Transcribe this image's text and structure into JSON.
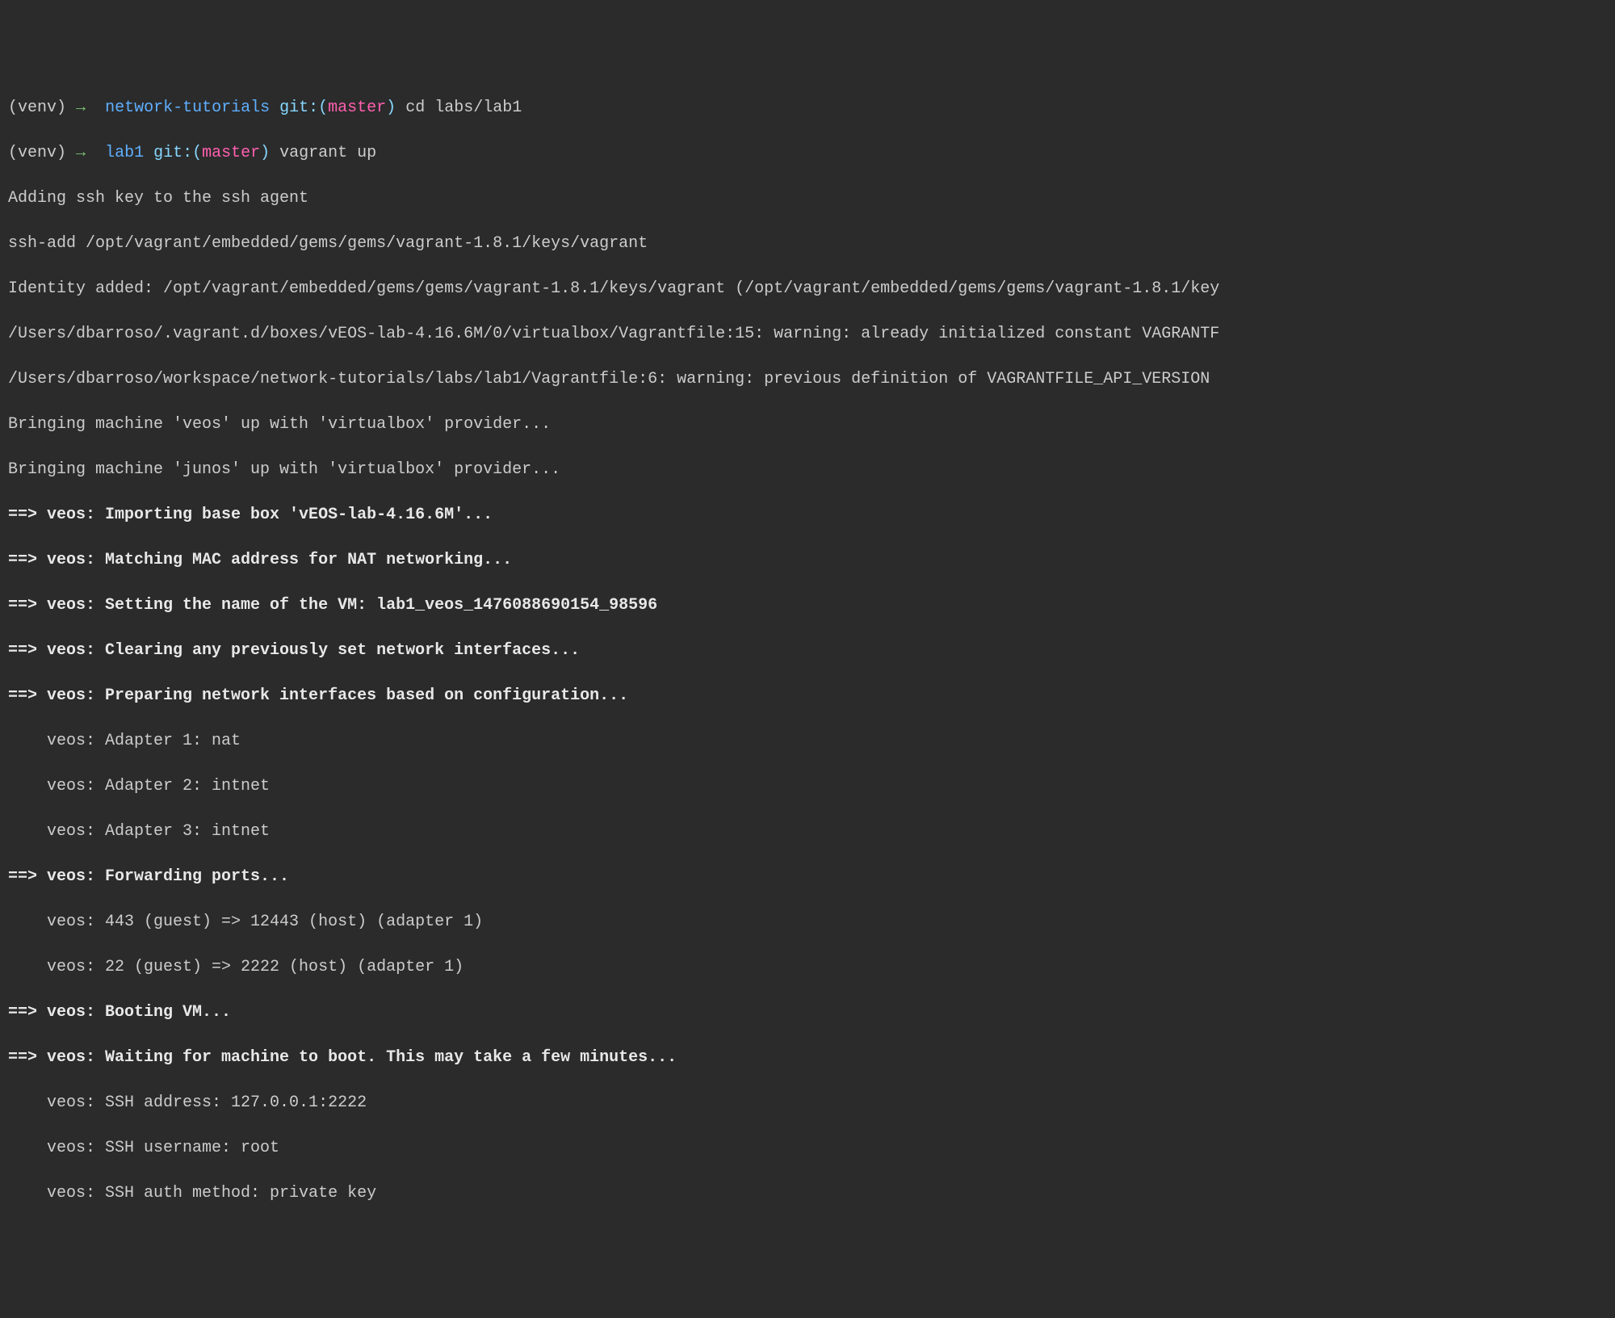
{
  "prompt1": {
    "venv": "(venv)",
    "arrow": "→",
    "dir": "network-tutorials",
    "git_label": "git:(",
    "branch": "master",
    "git_close": ")",
    "command": "cd labs/lab1"
  },
  "prompt2": {
    "venv": "(venv)",
    "arrow": "→",
    "dir": "lab1",
    "git_label": "git:(",
    "branch": "master",
    "git_close": ")",
    "command": "vagrant up"
  },
  "lines": {
    "l3": "Adding ssh key to the ssh agent",
    "l4": "ssh-add /opt/vagrant/embedded/gems/gems/vagrant-1.8.1/keys/vagrant",
    "l5": "Identity added: /opt/vagrant/embedded/gems/gems/vagrant-1.8.1/keys/vagrant (/opt/vagrant/embedded/gems/gems/vagrant-1.8.1/key",
    "l6": "/Users/dbarroso/.vagrant.d/boxes/vEOS-lab-4.16.6M/0/virtualbox/Vagrantfile:15: warning: already initialized constant VAGRANTF",
    "l7": "/Users/dbarroso/workspace/network-tutorials/labs/lab1/Vagrantfile:6: warning: previous definition of VAGRANTFILE_API_VERSION ",
    "l8": "Bringing machine 'veos' up with 'virtualbox' provider...",
    "l9": "Bringing machine 'junos' up with 'virtualbox' provider...",
    "l10": "==> veos: Importing base box 'vEOS-lab-4.16.6M'...",
    "l11": "==> veos: Matching MAC address for NAT networking...",
    "l12": "==> veos: Setting the name of the VM: lab1_veos_1476088690154_98596",
    "l13": "==> veos: Clearing any previously set network interfaces...",
    "l14": "==> veos: Preparing network interfaces based on configuration...",
    "l15": "    veos: Adapter 1: nat",
    "l16": "    veos: Adapter 2: intnet",
    "l17": "    veos: Adapter 3: intnet",
    "l18": "==> veos: Forwarding ports...",
    "l19": "    veos: 443 (guest) => 12443 (host) (adapter 1)",
    "l20": "    veos: 22 (guest) => 2222 (host) (adapter 1)",
    "l21": "==> veos: Booting VM...",
    "l22": "==> veos: Waiting for machine to boot. This may take a few minutes...",
    "l23": "    veos: SSH address: 127.0.0.1:2222",
    "l24": "    veos: SSH username: root",
    "l25": "    veos: SSH auth method: private key"
  }
}
